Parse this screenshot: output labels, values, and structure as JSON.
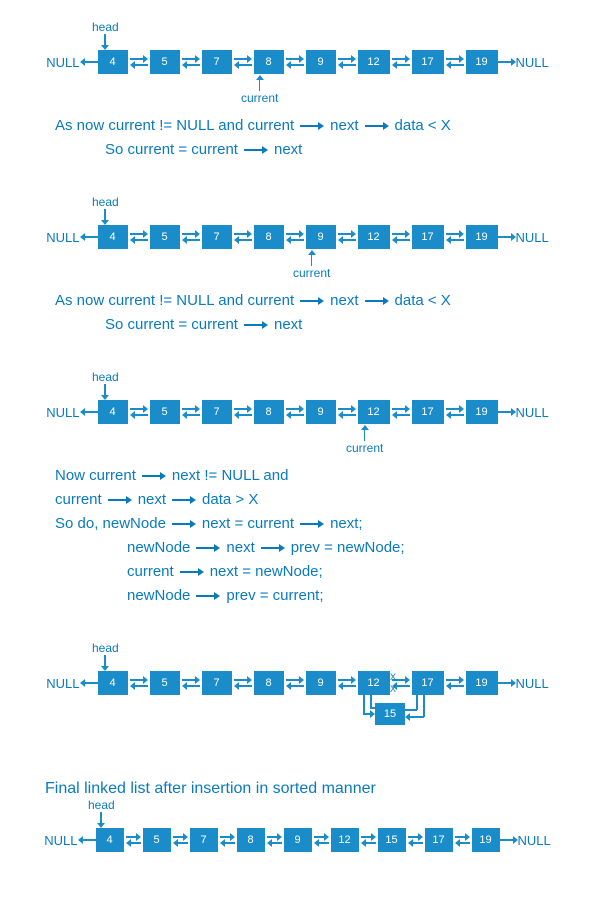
{
  "null_label": "NULL",
  "head_label": "head",
  "current_label": "current",
  "nodes_8": [
    "4",
    "5",
    "7",
    "8",
    "9",
    "12",
    "17",
    "19"
  ],
  "nodes_9": [
    "4",
    "5",
    "7",
    "8",
    "9",
    "12",
    "15",
    "17",
    "19"
  ],
  "inserted_value": "15",
  "text1": {
    "l1_a": "As  now  current != NULL  and  current",
    "l1_b": "next",
    "l1_c": "data  <  X",
    "l2_a": "So  current = current",
    "l2_b": "next"
  },
  "text3": {
    "l1_a": "Now  current",
    "l1_b": "next != NULL   and",
    "l2_a": "current",
    "l2_b": "next",
    "l2_c": "data  >  X",
    "l3": "So do,   newNode",
    "l3_b": "next = current",
    "l3_c": "next;",
    "l4_a": "newNode",
    "l4_b": "next",
    "l4_c": "prev = newNode;",
    "l5_a": "current",
    "l5_b": "next = newNode;",
    "l6_a": "newNode",
    "l6_b": "prev = current;"
  },
  "final_title": "Final linked list after insertion in sorted manner",
  "x_char": "X"
}
